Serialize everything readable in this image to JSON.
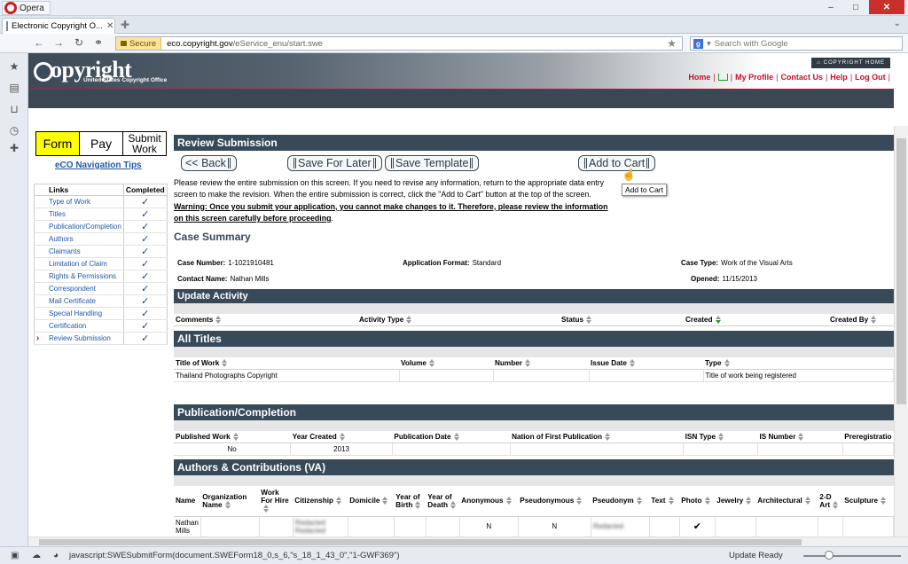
{
  "browser": {
    "app_name": "Opera",
    "tab_title": "Electronic Copyright O...",
    "secure_label": "Secure",
    "url_host": "eco.copyright.gov",
    "url_path": "/eService_enu/start.swe",
    "search_placeholder": "Search with Google",
    "status_text": "javascript:SWESubmitForm(document.SWEForm18_0,s_6,\"s_18_1_43_0\",\"1-GWF369\")",
    "update_text": "Update Ready"
  },
  "header": {
    "logo_text": "opyright",
    "logo_sub": "United States Copyright Office",
    "home_badge": "COPYRIGHT HOME",
    "links": [
      "Home",
      "My Profile",
      "Contact Us",
      "Help",
      "Log Out"
    ]
  },
  "leftnav": {
    "steps": [
      "Form",
      "Pay",
      "Submit Work"
    ],
    "tips_link": "eCO Navigation Tips",
    "col_links": "Links",
    "col_completed": "Completed",
    "items": [
      {
        "label": "Type of Work"
      },
      {
        "label": "Titles"
      },
      {
        "label": "Publication/Completion"
      },
      {
        "label": "Authors"
      },
      {
        "label": "Claimants"
      },
      {
        "label": "Limitation of Claim"
      },
      {
        "label": "Rights & Permissions"
      },
      {
        "label": "Correspondent"
      },
      {
        "label": "Mail Certificate"
      },
      {
        "label": "Special Handling"
      },
      {
        "label": "Certification"
      },
      {
        "label": "Review Submission"
      }
    ],
    "check": "✓"
  },
  "review": {
    "title": "Review Submission",
    "buttons": {
      "back": "<< Back",
      "save_later": "Save For Later",
      "save_template": "Save Template",
      "add_cart": "Add to Cart"
    },
    "tooltip": "Add to Cart",
    "text": "Please review the entire submission on this screen. If you need to revise any information, return to the appropriate data entry screen to make the revision. When the entire submission is correct, click the \"Add to Cart\" button at the top of the screen.",
    "warning": "Warning: Once you submit your application, you cannot make changes to it. Therefore, please review the information on this screen carefully before proceeding",
    "warning_end": "."
  },
  "case_summary": {
    "title": "Case Summary",
    "case_number_label": "Case Number:",
    "case_number": "1-1021910481",
    "app_format_label": "Application Format:",
    "app_format": "Standard",
    "case_type_label": "Case Type:",
    "case_type": "Work of the Visual Arts",
    "contact_label": "Contact Name:",
    "contact": "Nathan Mills",
    "opened_label": "Opened:",
    "opened": "11/15/2013"
  },
  "update_activity": {
    "title": "Update Activity",
    "columns": [
      "Comments",
      "Activity Type",
      "Status",
      "Created",
      "Created By"
    ]
  },
  "all_titles": {
    "title": "All Titles",
    "columns": [
      "Title of Work",
      "Volume",
      "Number",
      "Issue Date",
      "Type"
    ],
    "row": [
      "Thailand Photographs Copyright",
      "",
      "",
      "",
      "Title of work being registered"
    ]
  },
  "publication": {
    "title": "Publication/Completion",
    "columns": [
      "Published Work",
      "Year Created",
      "Publication Date",
      "Nation of First Publication",
      "ISN Type",
      "IS Number",
      "Preregistratio"
    ],
    "row": [
      "No",
      "2013",
      "",
      "",
      "",
      "",
      ""
    ]
  },
  "authors": {
    "title": "Authors & Contributions (VA)",
    "columns": [
      "Name",
      "Organization Name",
      "Work For Hire",
      "Citizenship",
      "Domicile",
      "Year of Birth",
      "Year of Death",
      "Anonymous",
      "Pseudonymous",
      "Pseudonym",
      "Text",
      "Photo",
      "Jewelry",
      "Architectural",
      "2-D Art",
      "Sculpture"
    ],
    "row": {
      "name": "Nathan Mills",
      "citizenship": "Redacted Redacted",
      "anonymous": "N",
      "pseudonymous": "N",
      "pseudonym": "Redacted",
      "photo": "✔"
    }
  }
}
